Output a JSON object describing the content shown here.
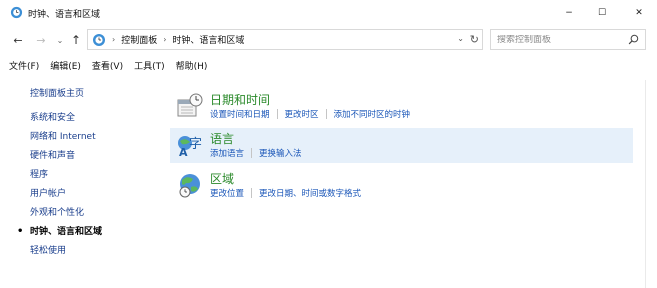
{
  "window": {
    "title": "时钟、语言和区域",
    "controls": {
      "minimize": "−",
      "maximize": "☐",
      "close": "✕"
    }
  },
  "navigation": {
    "back": "←",
    "forward": "→",
    "recent": "⌄",
    "up": "↑",
    "breadcrumbs": [
      "控制面板",
      "时钟、语言和区域"
    ],
    "search_placeholder": "搜索控制面板"
  },
  "menu": [
    "文件(F)",
    "编辑(E)",
    "查看(V)",
    "工具(T)",
    "帮助(H)"
  ],
  "sidebar": {
    "home": "控制面板主页",
    "items": [
      {
        "label": "系统和安全",
        "current": false
      },
      {
        "label": "网络和 Internet",
        "current": false
      },
      {
        "label": "硬件和声音",
        "current": false
      },
      {
        "label": "程序",
        "current": false
      },
      {
        "label": "用户帐户",
        "current": false
      },
      {
        "label": "外观和个性化",
        "current": false
      },
      {
        "label": "时钟、语言和区域",
        "current": true
      },
      {
        "label": "轻松使用",
        "current": false
      }
    ]
  },
  "categories": [
    {
      "title": "日期和时间",
      "icon": "calendar-clock-icon",
      "links": [
        "设置时间和日期",
        "更改时区",
        "添加不同时区的时钟"
      ],
      "selected": false
    },
    {
      "title": "语言",
      "icon": "language-icon",
      "links": [
        "添加语言",
        "更换输入法"
      ],
      "selected": true
    },
    {
      "title": "区域",
      "icon": "globe-clock-icon",
      "links": [
        "更改位置",
        "更改日期、时间或数字格式"
      ],
      "selected": false
    }
  ],
  "colors": {
    "category_title": "#2b8a2b",
    "link": "#1a56b8",
    "sidebar_link": "#1a3e8c",
    "selected_bg": "#e6f0fa"
  }
}
